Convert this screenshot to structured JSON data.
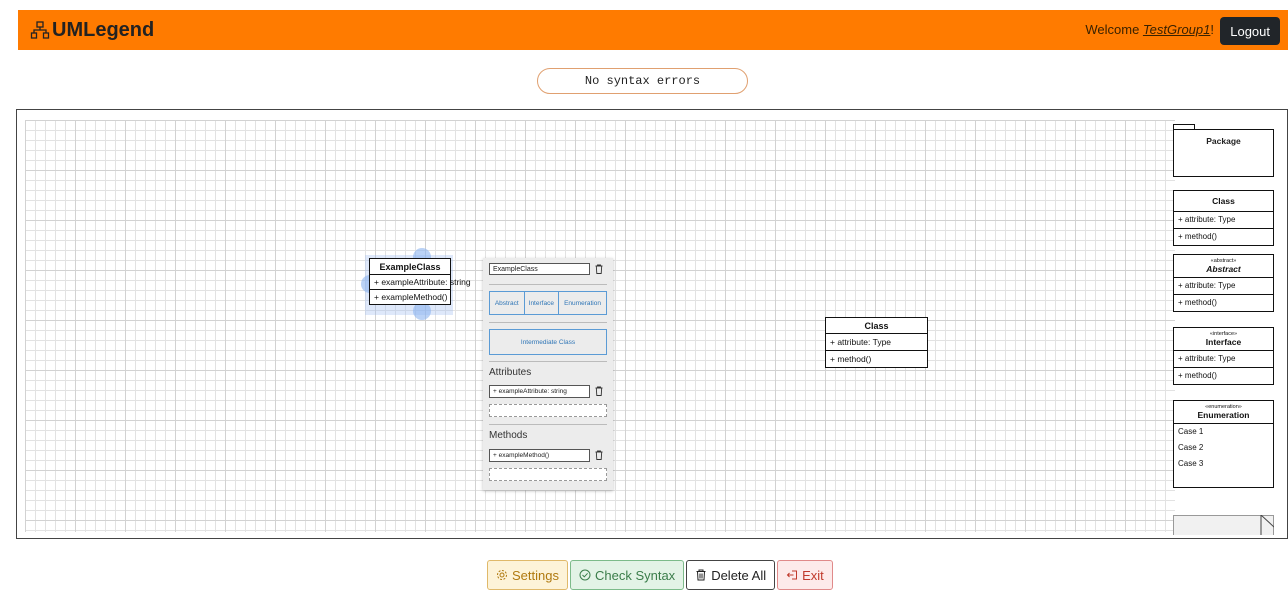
{
  "header": {
    "brand": "UMLegend",
    "welcome_prefix": "Welcome ",
    "username": "TestGroup1",
    "welcome_suffix": "!",
    "logout": "Logout",
    "accent": "#ff7b00"
  },
  "status": {
    "syntax": "No syntax errors"
  },
  "canvas": {
    "example_class": {
      "name": "ExampleClass",
      "attributes": [
        "+ exampleAttribute: string"
      ],
      "methods": [
        "+ exampleMethod()"
      ]
    },
    "placed_class": {
      "name": "Class",
      "attributes": [
        "+ attribute: Type"
      ],
      "methods": [
        "+ method()"
      ]
    }
  },
  "edit_panel": {
    "name_value": "ExampleClass",
    "types": [
      "Abstract",
      "Interface",
      "Enumeration"
    ],
    "intermediate": "Intermediate Class",
    "attributes_title": "Attributes",
    "attribute_value": "+ exampleAttribute: string",
    "methods_title": "Methods",
    "method_value": "+ exampleMethod()"
  },
  "palette": {
    "package": "Package",
    "class": {
      "name": "Class",
      "attribute": "+ attribute: Type",
      "method": "+ method()"
    },
    "abstract": {
      "stereotype": "«abstract»",
      "name": "Abstract",
      "attribute": "+ attribute: Type",
      "method": "+ method()"
    },
    "interface": {
      "stereotype": "«interface»",
      "name": "Interface",
      "attribute": "+ attribute: Type",
      "method": "+ method()"
    },
    "enumeration": {
      "stereotype": "«enumeration»",
      "name": "Enumeration",
      "cases": [
        "Case 1",
        "Case 2",
        "Case 3"
      ]
    }
  },
  "toolbar": {
    "settings": "Settings",
    "check_syntax": "Check Syntax",
    "delete_all": "Delete All",
    "exit": "Exit"
  }
}
